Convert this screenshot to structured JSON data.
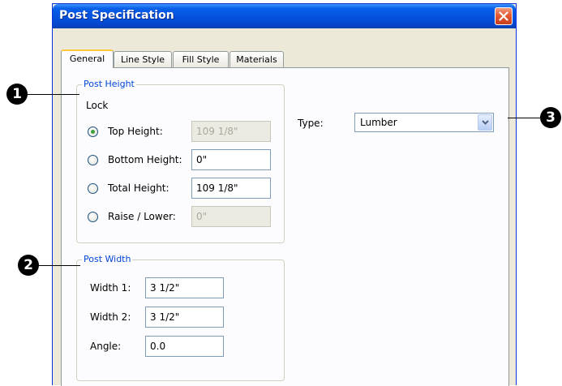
{
  "window": {
    "title": "Post Specification"
  },
  "tabs": [
    {
      "label": "General"
    },
    {
      "label": "Line Style"
    },
    {
      "label": "Fill Style"
    },
    {
      "label": "Materials"
    }
  ],
  "post_height": {
    "group_label": "Post Height",
    "lock_label": "Lock",
    "rows": [
      {
        "label": "Top Height:",
        "value": "109 1/8\"",
        "selected": true,
        "enabled": false
      },
      {
        "label": "Bottom Height:",
        "value": "0\"",
        "selected": false,
        "enabled": true
      },
      {
        "label": "Total Height:",
        "value": "109 1/8\"",
        "selected": false,
        "enabled": true
      },
      {
        "label": "Raise / Lower:",
        "value": "0\"",
        "selected": false,
        "enabled": false
      }
    ]
  },
  "post_width": {
    "group_label": "Post Width",
    "width1_label": "Width 1:",
    "width1_value": "3 1/2\"",
    "width2_label": "Width 2:",
    "width2_value": "3 1/2\"",
    "angle_label": "Angle:",
    "angle_value": "0.0"
  },
  "type_field": {
    "label": "Type:",
    "value": "Lumber"
  },
  "callouts": [
    "1",
    "2",
    "3"
  ],
  "colors": {
    "title_bar": "#0553de",
    "group_label": "#0046d5",
    "close_button": "#e35a34",
    "active_tab_accent": "#ffc73c"
  }
}
